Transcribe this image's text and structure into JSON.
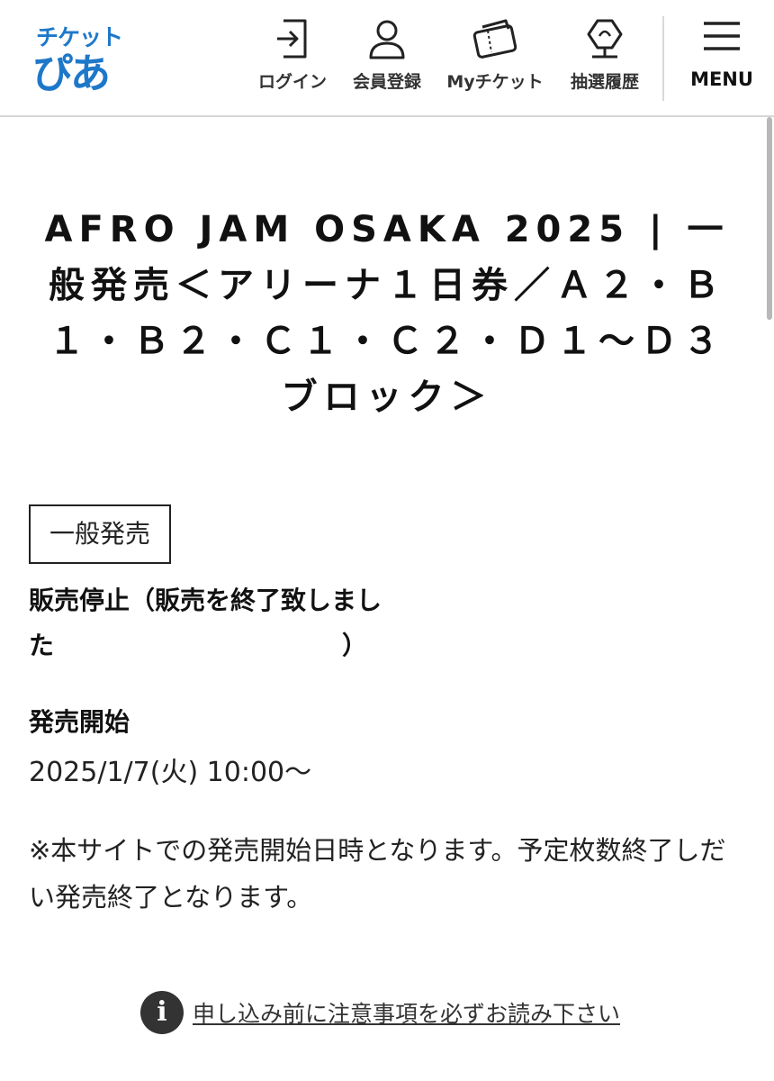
{
  "header": {
    "logo": {
      "top": "チケット",
      "bottom": "ぴあ"
    },
    "nav": [
      {
        "icon": "login-icon",
        "label": "ログイン"
      },
      {
        "icon": "user-icon",
        "label": "会員登録"
      },
      {
        "icon": "ticket-icon",
        "label": "Myチケット"
      },
      {
        "icon": "lottery-icon",
        "label": "抽選履歴"
      }
    ],
    "menu": {
      "icon": "hamburger-icon",
      "label": "MENU"
    }
  },
  "event": {
    "title": "AFRO JAM OSAKA 2025 | 一般発売＜アリーナ１日券／Ａ２・Ｂ１・Ｂ２・Ｃ１・Ｃ２・Ｄ１〜Ｄ３ブロック＞"
  },
  "sale": {
    "badge": "一般発売",
    "status_line1": "販売停止（販売を終了致しまし",
    "status_line2": "た",
    "status_close": "）",
    "start_label": "発売開始",
    "start_value": "2025/1/7(火) 10:00〜",
    "note": "※本サイトでの発売開始日時となります。予定枚数終了しだい発売終了となります。"
  },
  "notice": {
    "icon": "info-icon",
    "icon_glyph": "i",
    "link": "申し込み前に注意事項を必ずお読み下さい"
  },
  "colors": {
    "brand": "#1e78c9",
    "text": "#1a1a1a",
    "divider": "#d6d6d6"
  }
}
